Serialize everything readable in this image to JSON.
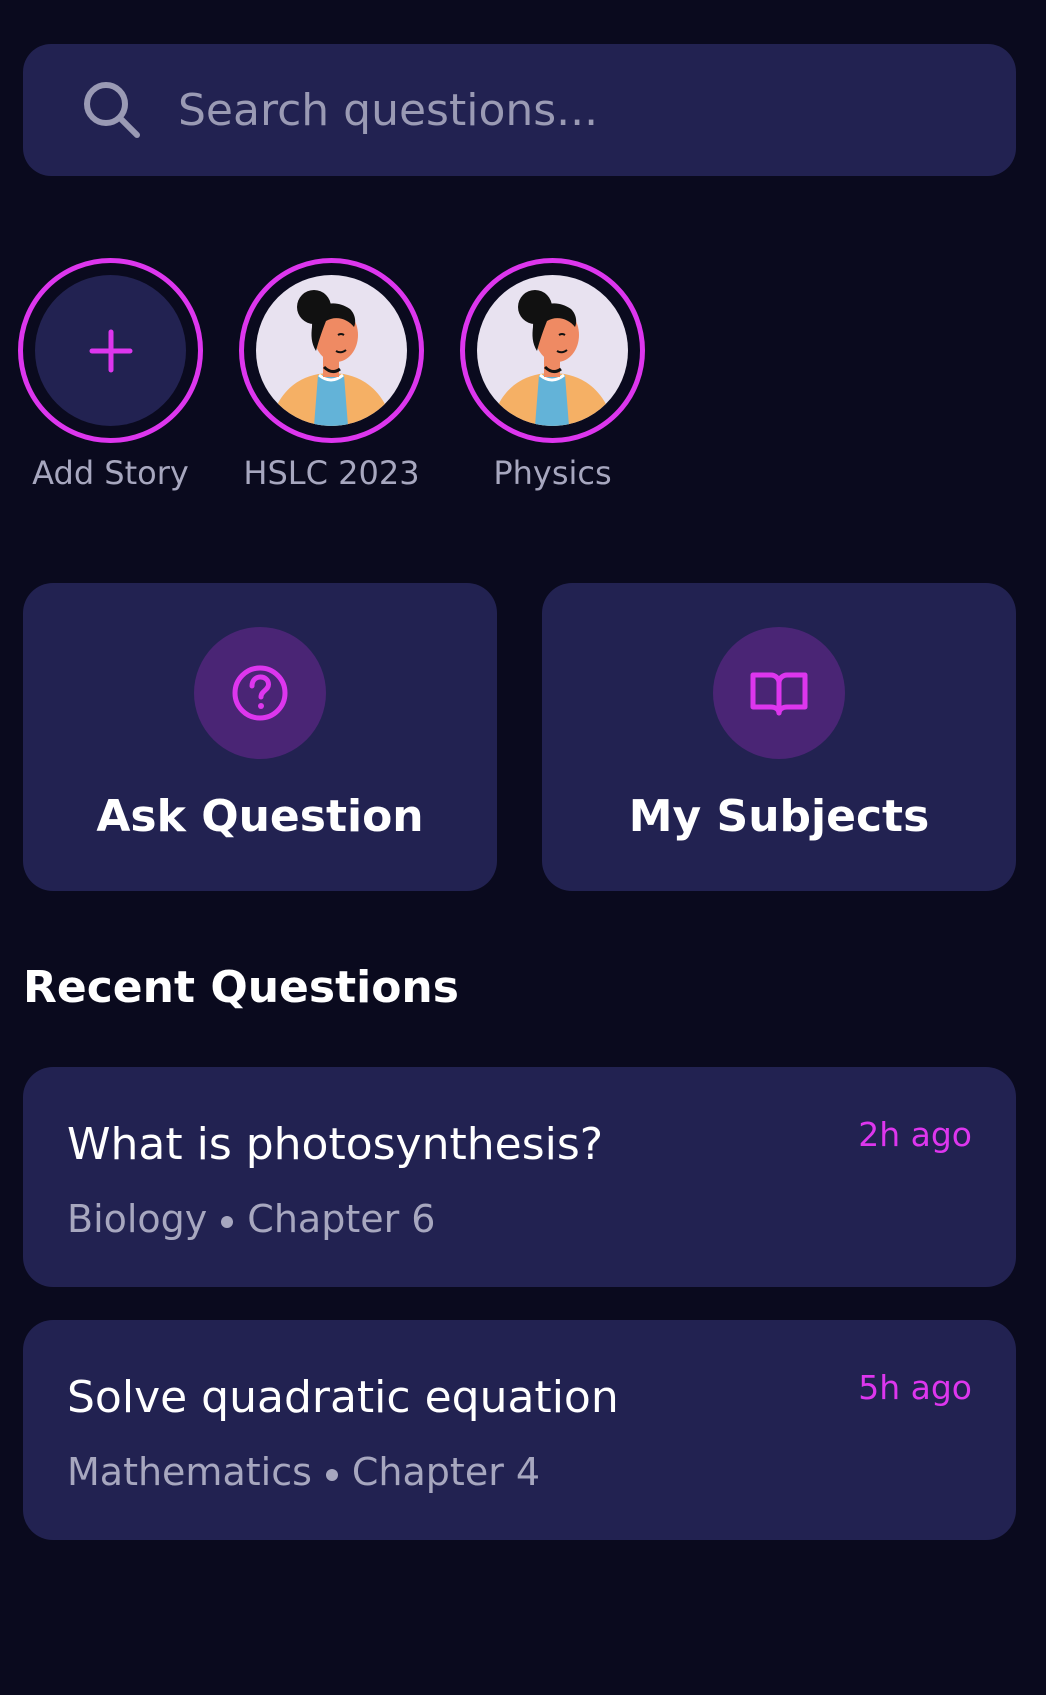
{
  "search": {
    "placeholder": "Search questions...",
    "icon": "search-icon"
  },
  "stories": [
    {
      "label": "Add Story",
      "type": "add",
      "icon": "plus-icon"
    },
    {
      "label": "HSLC 2023",
      "type": "avatar",
      "icon": "avatar-illustration"
    },
    {
      "label": "Physics",
      "type": "avatar",
      "icon": "avatar-illustration"
    }
  ],
  "actions": [
    {
      "label": "Ask Question",
      "icon": "question-circle-icon"
    },
    {
      "label": "My Subjects",
      "icon": "book-open-icon"
    }
  ],
  "recent": {
    "title": "Recent Questions",
    "items": [
      {
        "title": "What is photosynthesis?",
        "subject": "Biology",
        "chapter": "Chapter 6",
        "time": "2h ago"
      },
      {
        "title": "Solve quadratic equation",
        "subject": "Mathematics",
        "chapter": "Chapter 4",
        "time": "5h ago"
      }
    ]
  },
  "colors": {
    "background": "#0a0a1e",
    "card": "#222251",
    "accent": "#dd36ee",
    "icon_bg": "#4a2575",
    "muted_text": "#a7a7bf"
  }
}
